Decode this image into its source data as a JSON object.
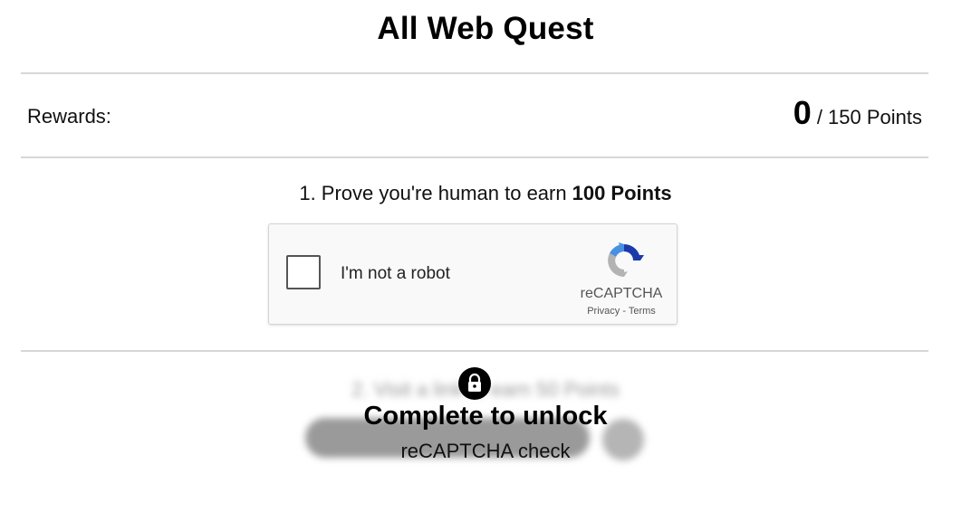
{
  "page": {
    "title": "All Web Quest"
  },
  "rewards": {
    "label": "Rewards:",
    "earned": "0",
    "total_text": "/ 150 Points"
  },
  "task1": {
    "text": "1. Prove you're human to earn",
    "reward": "100 Points"
  },
  "recaptcha": {
    "checkbox_label": "I'm not a robot",
    "brand": "reCAPTCHA",
    "privacy": "Privacy",
    "separator": " - ",
    "terms": "Terms",
    "logo_icon": "recaptcha-logo-icon",
    "colors": {
      "blue": "#1c3aa9",
      "light_blue": "#4a90e2",
      "gray": "#b3b3b3"
    }
  },
  "locked_section": {
    "blurred_text": "2. Visit a link to earn 50 Points",
    "lock_icon": "lock-icon",
    "title": "Complete to unlock",
    "subtitle": "reCAPTCHA check"
  }
}
